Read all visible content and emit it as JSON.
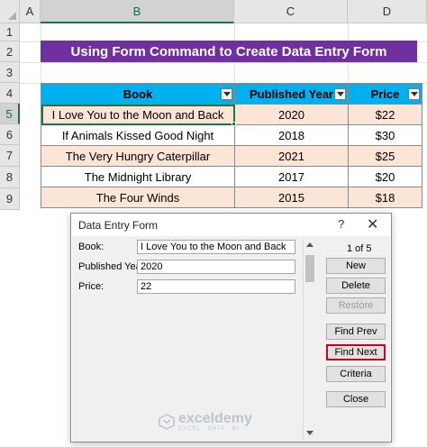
{
  "sheet": {
    "columns": [
      "A",
      "B",
      "C",
      "D"
    ],
    "rows": [
      "1",
      "2",
      "3",
      "4",
      "5",
      "6",
      "7",
      "8",
      "9"
    ],
    "banner": "Using Form Command to Create Data Entry Form",
    "table": {
      "headers": [
        "Book",
        "Published Year",
        "Price"
      ],
      "rows": [
        [
          "I Love You to the Moon and Back",
          "2020",
          "$22"
        ],
        [
          "If Animals Kissed Good Night",
          "2018",
          "$30"
        ],
        [
          "The Very Hungry Caterpillar",
          "2021",
          "$25"
        ],
        [
          "The Midnight Library",
          "2017",
          "$20"
        ],
        [
          "The Four Winds",
          "2015",
          "$18"
        ]
      ]
    }
  },
  "dialog": {
    "title": "Data Entry Form",
    "help": "?",
    "close": "✕",
    "fields": [
      {
        "label": "Book:",
        "value": "I Love You to the Moon and Back"
      },
      {
        "label": "Published Year:",
        "value": "2020"
      },
      {
        "label": "Price:",
        "value": "22"
      }
    ],
    "record_counter": "1 of 5",
    "buttons": {
      "new": "New",
      "delete": "Delete",
      "restore": "Restore",
      "find_prev": "Find Prev",
      "find_next": "Find Next",
      "criteria": "Criteria",
      "close": "Close"
    }
  },
  "watermark": {
    "name": "exceldemy",
    "tagline": "EXCEL · DATA · BI"
  },
  "colors": {
    "banner": "#7030a0",
    "header": "#00b0f0",
    "odd_row": "#fce4d6",
    "highlight": "#d0021b",
    "selection": "#217346"
  }
}
